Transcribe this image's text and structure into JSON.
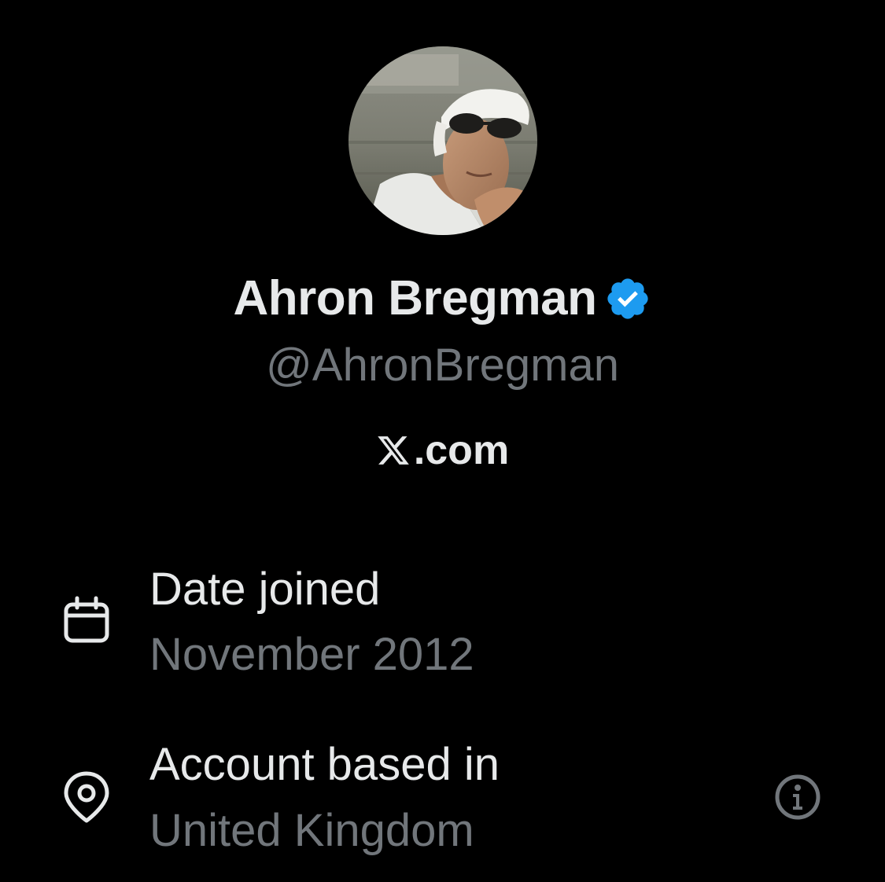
{
  "profile": {
    "display_name": "Ahron Bregman",
    "handle": "@AhronBregman",
    "verified": true,
    "verified_color": "#1d9bf0",
    "avatar_icon": "profile-photo"
  },
  "site": {
    "logo_icon": "x-logo",
    "text": ".com"
  },
  "details": {
    "date_joined": {
      "icon": "calendar-icon",
      "label": "Date joined",
      "value": "November 2012"
    },
    "account_based": {
      "icon": "location-pin-icon",
      "label": "Account based in",
      "value": "United Kingdom",
      "info_icon": "info-icon"
    }
  },
  "colors": {
    "background": "#000000",
    "primary_text": "#e7e9ea",
    "secondary_text": "#71767b"
  }
}
